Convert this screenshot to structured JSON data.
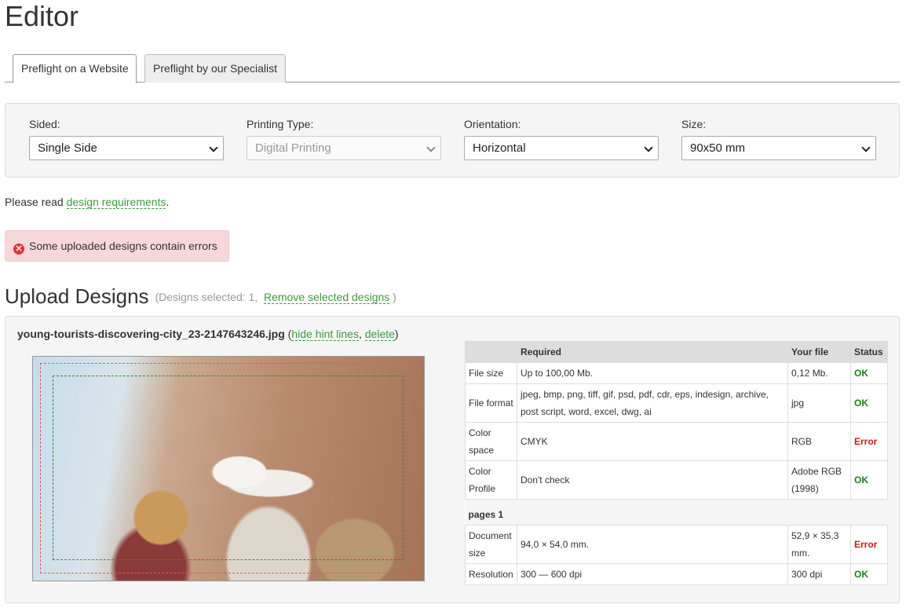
{
  "page": {
    "title": "Editor"
  },
  "tabs": [
    {
      "label": "Preflight on a Website",
      "active": true
    },
    {
      "label": "Preflight by our Specialist",
      "active": false
    }
  ],
  "options": {
    "sided": {
      "label": "Sided:",
      "value": "Single Side"
    },
    "printing_type": {
      "label": "Printing Type:",
      "value": "Digital Printing",
      "disabled": true
    },
    "orientation": {
      "label": "Orientation:",
      "value": "Horizontal"
    },
    "size": {
      "label": "Size:",
      "value": "90x50 mm"
    }
  },
  "requirements_note": {
    "prefix": "Please read ",
    "link": "design requirements",
    "suffix": "."
  },
  "alert": {
    "text": "Some uploaded designs contain errors",
    "icon": "error-circle-icon"
  },
  "upload": {
    "heading": "Upload Designs",
    "selected_prefix": "(Designs selected: 1,",
    "remove_link": "Remove selected designs",
    "selected_suffix": ")"
  },
  "design": {
    "filename": "young-tourists-discovering-city_23-2147643246.jpg",
    "paren_open": " (",
    "hide_hint_link": "hide hint lines",
    "comma": ", ",
    "delete_link": "delete",
    "paren_close": ")"
  },
  "table": {
    "headers": {
      "col1": "",
      "required": "Required",
      "your_file": "Your file",
      "status": "Status"
    },
    "rows": [
      {
        "name": "File size",
        "required": "Up to 100,00 Mb.",
        "your_file": "0,12 Mb.",
        "status": "OK"
      },
      {
        "name": "File format",
        "required": "jpeg, bmp, png, tiff, gif, psd, pdf, cdr, eps, indesign, archive, post script, word, excel, dwg, ai",
        "your_file": "jpg",
        "status": "OK"
      },
      {
        "name": "Color space",
        "required": "CMYK",
        "your_file": "RGB",
        "status": "Error"
      },
      {
        "name": "Color Profile",
        "required": "Don't check",
        "your_file": "Adobe RGB (1998)",
        "status": "OK"
      }
    ],
    "section": "pages 1",
    "page_rows": [
      {
        "name": "Document size",
        "required": "94,0 × 54,0 mm.",
        "your_file": "52,9 × 35,3 mm.",
        "status": "Error"
      },
      {
        "name": "Resolution",
        "required": "300 — 600 dpi",
        "your_file": "300 dpi",
        "status": "OK"
      }
    ]
  },
  "colors": {
    "link": "#3c9a3c",
    "ok": "#1e7e1e",
    "error": "#cc1a1a",
    "alert_bg": "#f8d7da"
  }
}
